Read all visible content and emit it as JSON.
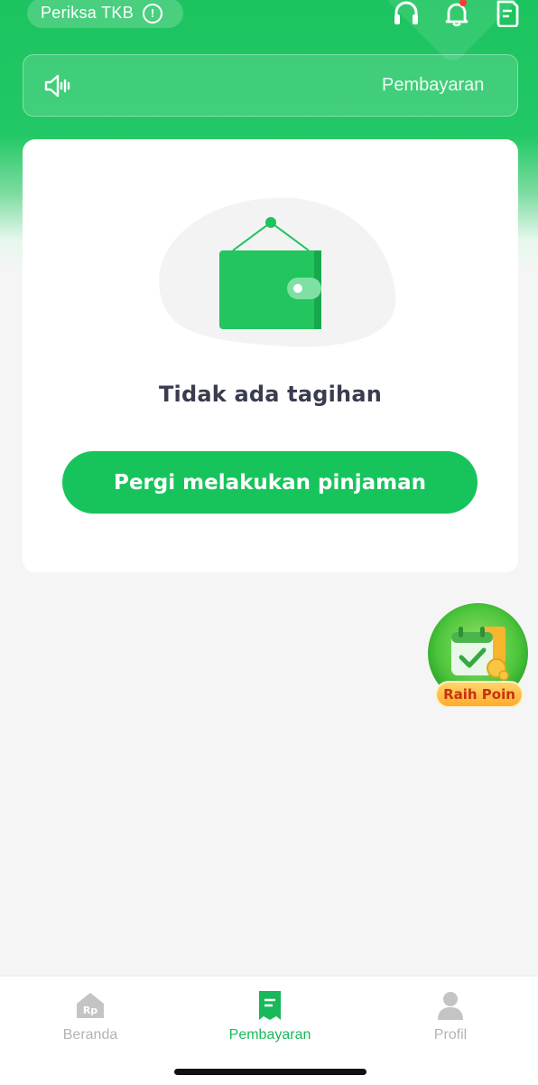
{
  "header": {
    "tkb_label": "Periksa TKB",
    "info_icon": "info-icon",
    "icons": [
      "headset-icon",
      "bell-icon",
      "document-icon"
    ],
    "notification_dot_color": "#ff3b30",
    "brand_color": "#1cc35f"
  },
  "announcement": {
    "icon": "speaker-icon",
    "text": "Pembayaran"
  },
  "empty_state": {
    "illustration": "wallet-icon",
    "message": "Tidak ada tagihan",
    "cta_label": "Pergi melakukan pinjaman"
  },
  "floating_badge": {
    "icon": "calendar-check-icon",
    "label": "Raih Poin"
  },
  "tabbar": {
    "items": [
      {
        "label": "Beranda",
        "icon": "home-rp-icon",
        "active": false
      },
      {
        "label": "Pembayaran",
        "icon": "receipt-icon",
        "active": true
      },
      {
        "label": "Profil",
        "icon": "user-icon",
        "active": false
      }
    ]
  }
}
